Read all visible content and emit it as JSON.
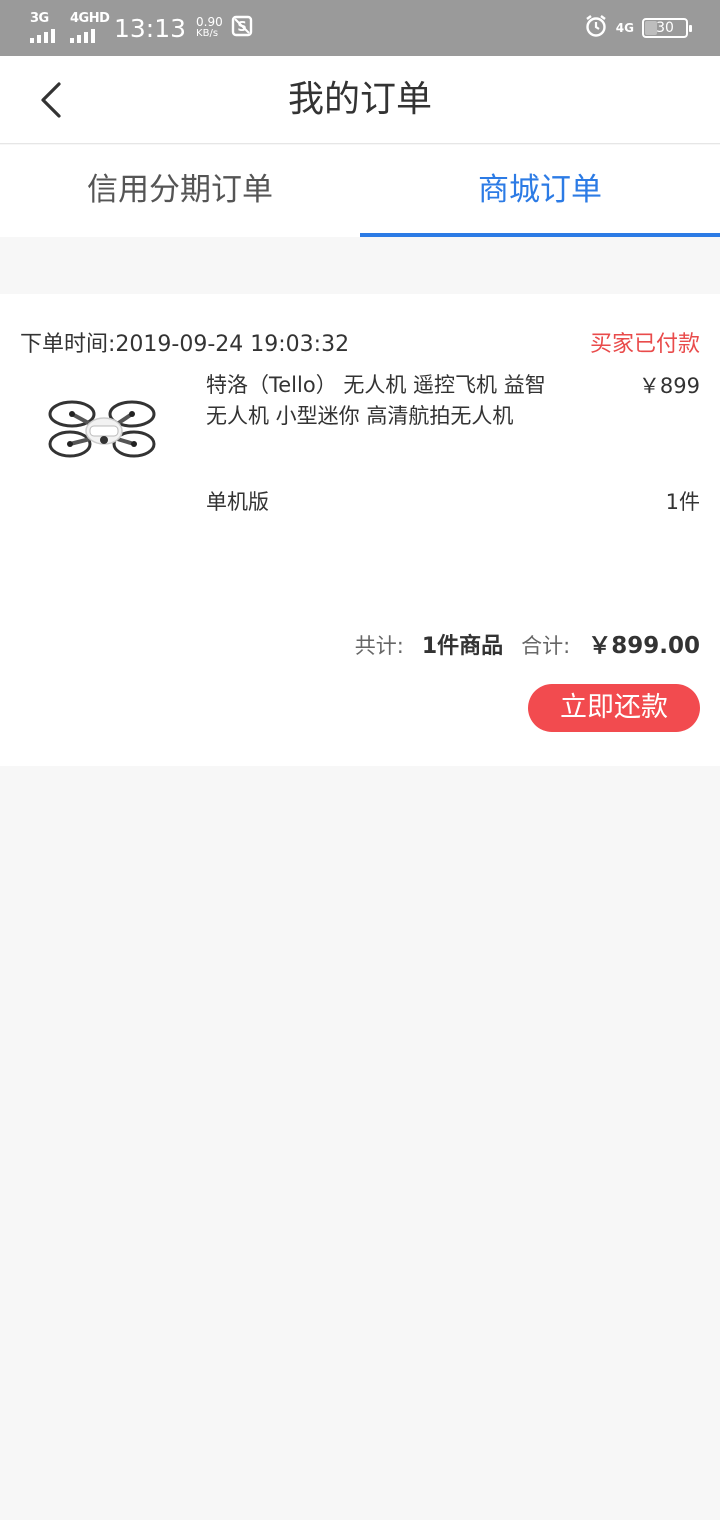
{
  "status_bar": {
    "sim1": "3G",
    "sim2": "4GHD",
    "time": "13:13",
    "speed_value": "0.90",
    "speed_unit": "KB/s",
    "net": "4G",
    "battery": "30",
    "icons": [
      "signal-icon",
      "screenshot-app-icon",
      "alarm-icon",
      "battery-icon"
    ]
  },
  "header": {
    "title": "我的订单",
    "back_icon": "chevron-left-icon"
  },
  "tabs": [
    {
      "label": "信用分期订单",
      "active": false
    },
    {
      "label": "商城订单",
      "active": true
    }
  ],
  "order": {
    "time": "下单时间:2019-09-24 19:03:32",
    "status": "买家已付款",
    "product": {
      "name": "特洛（Tello） 无人机 遥控飞机 益智无人机 小型迷你 高清航拍无人机",
      "price": "￥899",
      "spec": "单机版",
      "qty": "1件",
      "image_icon": "drone-image"
    },
    "summary": {
      "count_label": "共计:",
      "count_value": "1件商品",
      "total_label": "合计:",
      "total_value": "￥899.00"
    },
    "pay_button": "立即还款"
  },
  "colors": {
    "accent": "#2c7be5",
    "status_red": "#e94b4b",
    "button_red": "#f24b4f",
    "status_bar": "#9a9a9a",
    "page_bg": "#f7f7f7"
  }
}
